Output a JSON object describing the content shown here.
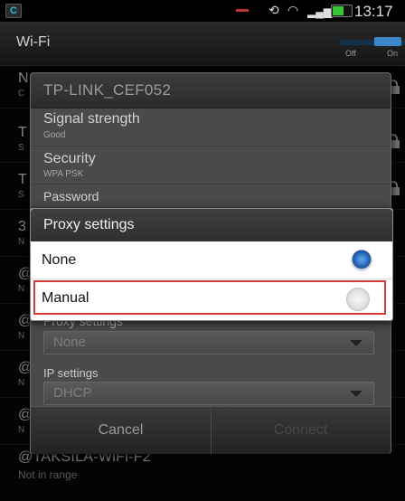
{
  "status_bar": {
    "time": "13:17",
    "battery_level": 0.6
  },
  "header": {
    "title": "Wi-Fi",
    "toggle_off": "Off",
    "toggle_on": "On"
  },
  "background_list": {
    "row_letters": [
      "N",
      "T",
      "T",
      "3",
      "@",
      "@",
      "@",
      "@"
    ],
    "row_subs": [
      "C",
      "S",
      "S",
      "N",
      "N",
      "N",
      "N",
      "N"
    ],
    "bottom_network": {
      "name": "@TAKSILA-WiFi-F2",
      "status": "Not in range"
    }
  },
  "network_dialog": {
    "title": "TP-LINK_CEF052",
    "signal_label": "Signal strength",
    "signal_value": "Good",
    "security_label": "Security",
    "security_value": "WPA PSK",
    "password_label": "Password",
    "proxy_label": "Proxy settings",
    "proxy_value": "None",
    "ip_label": "IP settings",
    "ip_value": "DHCP",
    "cancel_label": "Cancel",
    "connect_label": "Connect"
  },
  "proxy_dialog": {
    "title": "Proxy settings",
    "options": [
      {
        "label": "None",
        "selected": true
      },
      {
        "label": "Manual",
        "selected": false
      }
    ]
  },
  "colors": {
    "accent": "#2a6cc2",
    "highlight_border": "#d23a3a",
    "battery": "#35c735"
  }
}
